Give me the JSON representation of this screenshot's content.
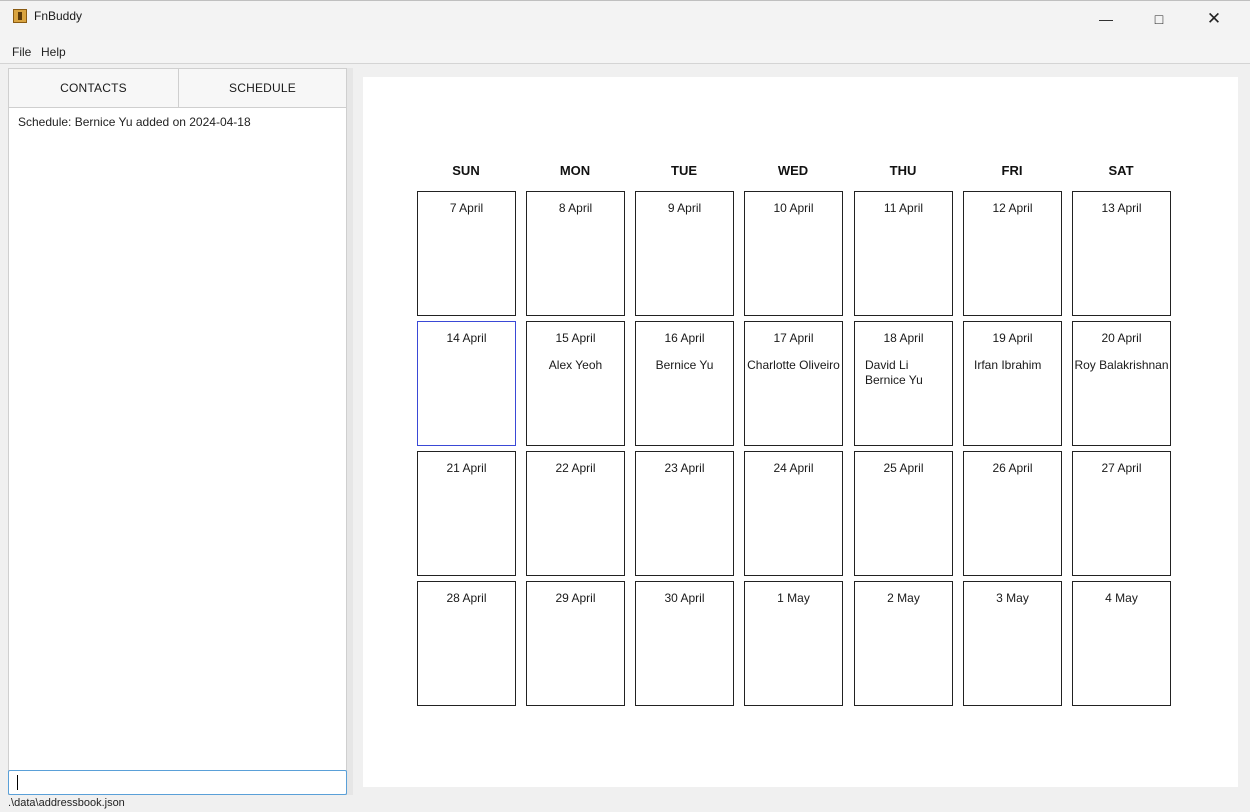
{
  "window": {
    "title": "FnBuddy"
  },
  "menu": {
    "file": "File",
    "help": "Help"
  },
  "tabs": {
    "contacts": "CONTACTS",
    "schedule": "SCHEDULE"
  },
  "feedback": "Schedule: Bernice Yu added on 2024-04-18",
  "command": {
    "value": ""
  },
  "status": {
    "path": ".\\data\\addressbook.json"
  },
  "calendar": {
    "days": [
      "SUN",
      "MON",
      "TUE",
      "WED",
      "THU",
      "FRI",
      "SAT"
    ],
    "weeks": [
      [
        {
          "date": "7 April",
          "names": []
        },
        {
          "date": "8 April",
          "names": []
        },
        {
          "date": "9 April",
          "names": []
        },
        {
          "date": "10 April",
          "names": []
        },
        {
          "date": "11 April",
          "names": []
        },
        {
          "date": "12 April",
          "names": []
        },
        {
          "date": "13 April",
          "names": []
        }
      ],
      [
        {
          "date": "14 April",
          "names": [],
          "today": true
        },
        {
          "date": "15 April",
          "names": [
            "Alex Yeoh"
          ]
        },
        {
          "date": "16 April",
          "names": [
            "Bernice Yu"
          ]
        },
        {
          "date": "17 April",
          "names": [
            "Charlotte Oliveiro"
          ]
        },
        {
          "date": "18 April",
          "names": [
            "David Li",
            "Bernice Yu"
          ]
        },
        {
          "date": "19 April",
          "names": [
            "Irfan Ibrahim"
          ]
        },
        {
          "date": "20 April",
          "names": [
            "Roy Balakrishnan"
          ]
        }
      ],
      [
        {
          "date": "21 April",
          "names": []
        },
        {
          "date": "22 April",
          "names": []
        },
        {
          "date": "23 April",
          "names": []
        },
        {
          "date": "24 April",
          "names": []
        },
        {
          "date": "25 April",
          "names": []
        },
        {
          "date": "26 April",
          "names": []
        },
        {
          "date": "27 April",
          "names": []
        }
      ],
      [
        {
          "date": "28 April",
          "names": []
        },
        {
          "date": "29 April",
          "names": []
        },
        {
          "date": "30 April",
          "names": []
        },
        {
          "date": "1 May",
          "names": []
        },
        {
          "date": "2 May",
          "names": []
        },
        {
          "date": "3 May",
          "names": []
        },
        {
          "date": "4 May",
          "names": []
        }
      ]
    ]
  }
}
